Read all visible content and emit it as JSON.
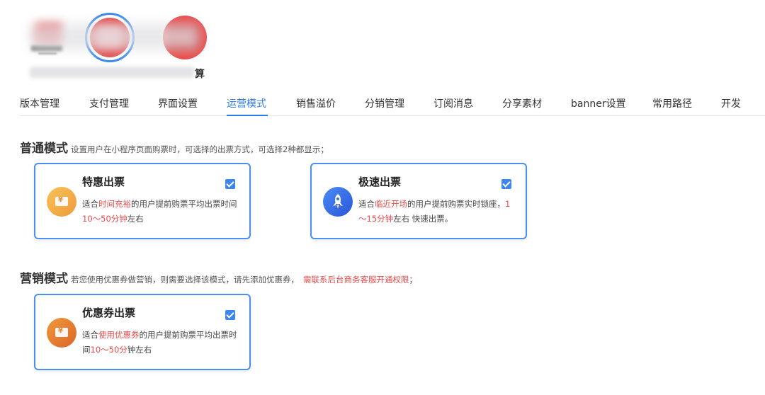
{
  "header": {
    "name_tail": "算"
  },
  "tabs": [
    {
      "label": "版本管理",
      "active": false
    },
    {
      "label": "支付管理",
      "active": false
    },
    {
      "label": "界面设置",
      "active": false
    },
    {
      "label": "运营模式",
      "active": true
    },
    {
      "label": "销售溢价",
      "active": false
    },
    {
      "label": "分销管理",
      "active": false
    },
    {
      "label": "订阅消息",
      "active": false
    },
    {
      "label": "分享素材",
      "active": false
    },
    {
      "label": "banner设置",
      "active": false
    },
    {
      "label": "常用路径",
      "active": false
    },
    {
      "label": "开发",
      "active": false
    }
  ],
  "normal_mode": {
    "title": "普通模式",
    "desc": "设置用户在小程序页面购票时，可选择的出票方式，可选择2种都显示；",
    "cards": [
      {
        "title": "特惠出票",
        "checked": true,
        "icon": "ticket-icon",
        "desc_p1": "适合",
        "desc_hl1": "时间充裕",
        "desc_p2": "的用户提前购票平均出票时间",
        "desc_hl2": "10～50分钟",
        "desc_p3": "左右"
      },
      {
        "title": "极速出票",
        "checked": true,
        "icon": "rocket-icon",
        "desc_p1": "适合",
        "desc_hl1": "临近开场",
        "desc_p2": "的用户提前购票实时锁座，",
        "desc_hl2": "1～15分钟",
        "desc_p3": "左右 快速出票。"
      }
    ]
  },
  "marketing_mode": {
    "title": "营销模式",
    "desc": "若您使用优惠券做营销，则需要选择该模式，请先添加优惠券，",
    "desc_red": "需联系后台商务客服开通权限",
    "desc_end": "；",
    "cards": [
      {
        "title": "优惠券出票",
        "checked": true,
        "icon": "coupon-ticket-icon",
        "desc_p1": "适合",
        "desc_hl1": "使用优惠券",
        "desc_p2": "的用户提前购票平均出票时间",
        "desc_hl2": "10～50分",
        "desc_p3": "钟左右"
      }
    ]
  },
  "colors": {
    "accent": "#2f7be5",
    "highlight": "#e64b4b",
    "card_border": "#4d8ff0"
  }
}
